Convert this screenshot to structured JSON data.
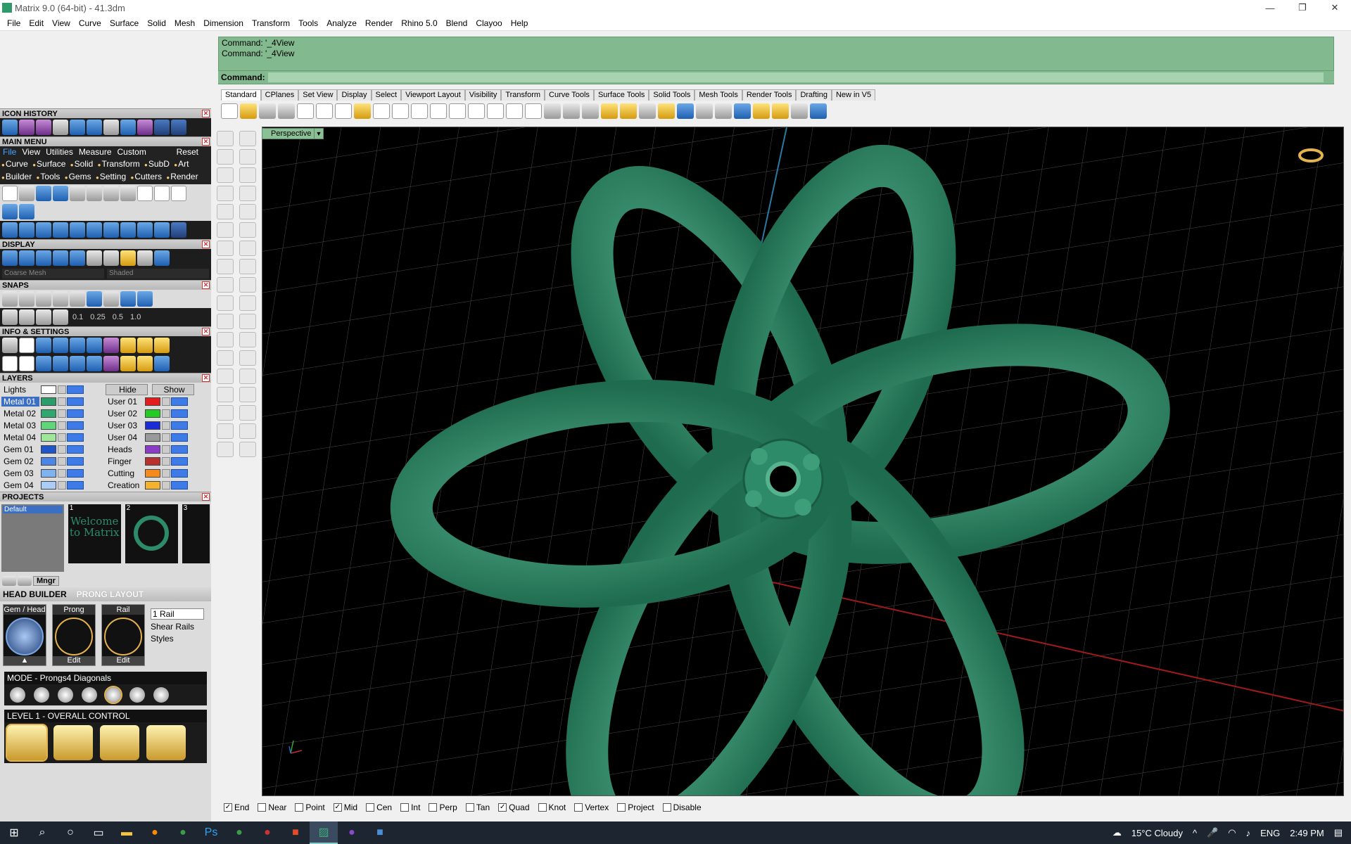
{
  "window": {
    "title": "Matrix 9.0 (64-bit) - 41.3dm",
    "minimize": "—",
    "restore": "❐",
    "close": "✕"
  },
  "menu": [
    "File",
    "Edit",
    "View",
    "Curve",
    "Surface",
    "Solid",
    "Mesh",
    "Dimension",
    "Transform",
    "Tools",
    "Analyze",
    "Render",
    "Rhino 5.0",
    "Blend",
    "Clayoo",
    "Help"
  ],
  "panels": {
    "icon_history": "ICON HISTORY",
    "main_menu": "MAIN MENU",
    "main_menu_tabs": [
      "File",
      "View",
      "Utilities",
      "Measure",
      "Custom"
    ],
    "main_menu_reset": "Reset",
    "main_menu_links_1": [
      "Curve",
      "Surface",
      "Solid",
      "Transform",
      "SubD",
      "Art"
    ],
    "main_menu_links_2": [
      "Builder",
      "Tools",
      "Gems",
      "Setting",
      "Cutters",
      "Render"
    ],
    "display": "DISPLAY",
    "display_mesh": "Coarse Mesh",
    "display_mode": "Shaded",
    "snaps": "SNAPS",
    "snap_values": [
      "0.1",
      "0.25",
      "0.5",
      "1.0"
    ],
    "info_settings": "INFO & SETTINGS",
    "layers": "LAYERS",
    "projects": "PROJECTS",
    "project_default": "Default",
    "project_mgr": "Mngr",
    "head_builder": "HEAD  BUILDER",
    "prong_layout": "PRONG LAYOUT"
  },
  "layers": {
    "lights": "Lights",
    "hide": "Hide",
    "show": "Show",
    "left": [
      {
        "name": "Metal 01",
        "color": "#2a9d6a"
      },
      {
        "name": "Metal 02",
        "color": "#2fa86f"
      },
      {
        "name": "Metal 03",
        "color": "#5fd67a"
      },
      {
        "name": "Metal 04",
        "color": "#9ee79a"
      },
      {
        "name": "Gem 01",
        "color": "#1f56c7"
      },
      {
        "name": "Gem 02",
        "color": "#4a86e8"
      },
      {
        "name": "Gem 03",
        "color": "#7fb3f0"
      },
      {
        "name": "Gem 04",
        "color": "#a9cdf7"
      }
    ],
    "right": [
      {
        "name": "User 01",
        "color": "#e21d1d"
      },
      {
        "name": "User 02",
        "color": "#22cc22"
      },
      {
        "name": "User 03",
        "color": "#1b2bd6"
      },
      {
        "name": "User 04",
        "color": "#9a9a9a"
      },
      {
        "name": "Heads",
        "color": "#8a3cc7"
      },
      {
        "name": "Finger",
        "color": "#b83030"
      },
      {
        "name": "Cutting",
        "color": "#f58b1f"
      },
      {
        "name": "Creation",
        "color": "#f4b32a"
      }
    ]
  },
  "project_thumbs": [
    {
      "num": "1",
      "text": "Welcome to Matrix"
    },
    {
      "num": "2",
      "text": ""
    },
    {
      "num": "3",
      "text": ""
    }
  ],
  "head_builder": {
    "boxes": [
      {
        "cap": "Gem / Head",
        "foot": "▲"
      },
      {
        "cap": "Prong",
        "foot": "Edit"
      },
      {
        "cap": "Rail",
        "foot": "Edit"
      }
    ],
    "rail_select": "1 Rail",
    "shear_rails": "Shear Rails",
    "styles": "Styles",
    "mode": "MODE - Prongs4 Diagonals",
    "level": "LEVEL 1 - OVERALL CONTROL"
  },
  "command": {
    "history": [
      "Command: '_4View",
      "Command: '_4View"
    ],
    "prompt": "Command:"
  },
  "toolbar_tabs": [
    "Standard",
    "CPlanes",
    "Set View",
    "Display",
    "Select",
    "Viewport Layout",
    "Visibility",
    "Transform",
    "Curve Tools",
    "Surface Tools",
    "Solid Tools",
    "Mesh Tools",
    "Render Tools",
    "Drafting",
    "New in V5"
  ],
  "viewport": {
    "label": "Perspective"
  },
  "osnaps": [
    {
      "label": "End",
      "checked": true
    },
    {
      "label": "Near",
      "checked": false
    },
    {
      "label": "Point",
      "checked": false
    },
    {
      "label": "Mid",
      "checked": true
    },
    {
      "label": "Cen",
      "checked": false
    },
    {
      "label": "Int",
      "checked": false
    },
    {
      "label": "Perp",
      "checked": false
    },
    {
      "label": "Tan",
      "checked": false
    },
    {
      "label": "Quad",
      "checked": true
    },
    {
      "label": "Knot",
      "checked": false
    },
    {
      "label": "Vertex",
      "checked": false
    },
    {
      "label": "Project",
      "checked": false
    },
    {
      "label": "Disable",
      "checked": false
    }
  ],
  "taskbar": {
    "weather": "15°C  Cloudy",
    "lang": "ENG",
    "time": "2:49 PM"
  },
  "colors": {
    "model": "#2e8b6a",
    "command_bg": "#82b98e",
    "accent": "#3e7be6"
  }
}
